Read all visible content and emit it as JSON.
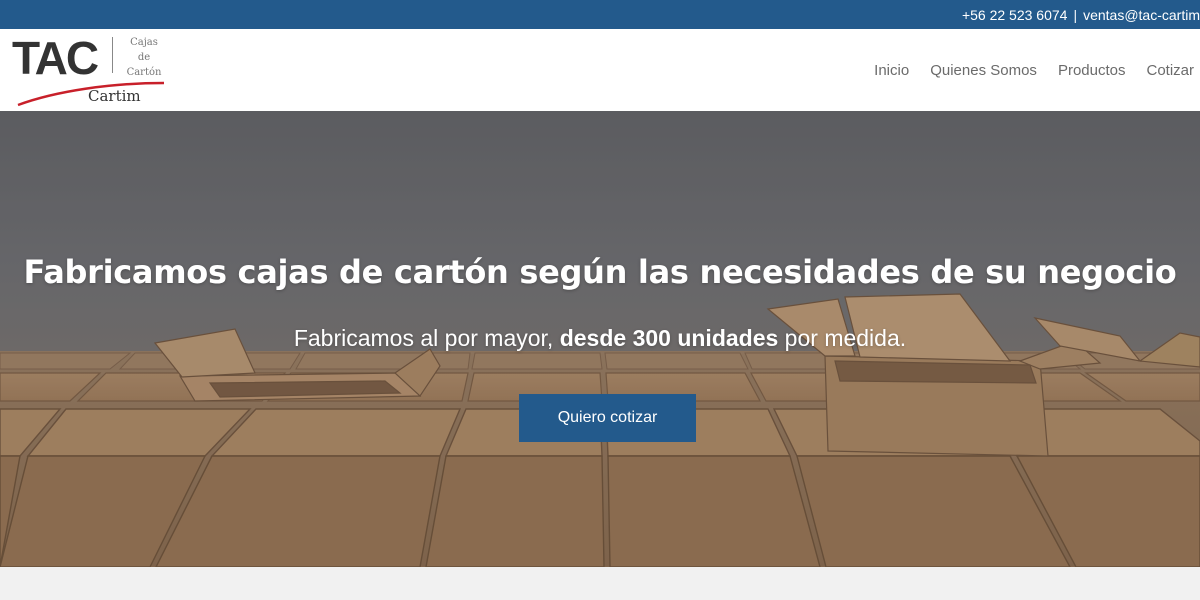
{
  "topbar": {
    "phone": "+56 22 523 6074",
    "separator": "|",
    "email": "ventas@tac-cartim.cl"
  },
  "logo": {
    "main": "TAC",
    "sub_lines": [
      "Cajas",
      "de",
      "Cartón"
    ],
    "brand": "Cartim"
  },
  "nav": {
    "items": [
      "Inicio",
      "Quienes Somos",
      "Productos",
      "Cotizar"
    ]
  },
  "hero": {
    "title": "Fabricamos cajas de cartón según las necesidades de su negocio",
    "subtitle_pre": "Fabricamos al por mayor, ",
    "subtitle_bold": "desde 300 unidades",
    "subtitle_post": " por medida.",
    "cta_label": "Quiero cotizar"
  },
  "colors": {
    "brand_blue": "#235a8c",
    "swoosh_red": "#c8202a"
  }
}
